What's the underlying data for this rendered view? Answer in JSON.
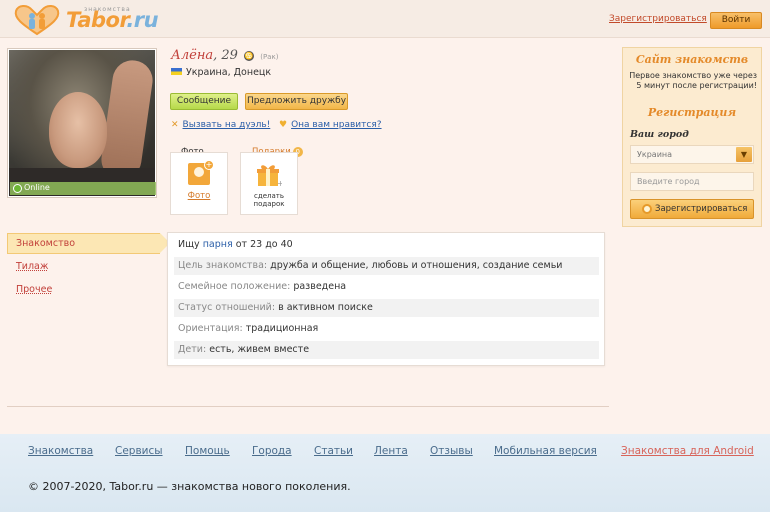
{
  "header": {
    "logo_text": "Tabor",
    "logo_tld": ".ru",
    "logo_subtitle": "знакомства",
    "register_label": "Зарегистрироваться",
    "login_label": "Войти"
  },
  "profile": {
    "name": "Алёна",
    "age": "29",
    "zodiac_label": "(Рак)",
    "location": "Украина, Донецк",
    "online_label": "Online",
    "message_button": "Сообщение",
    "friend_button": "Предложить дружбу",
    "duel_link": "Вызвать на дуэль!",
    "like_link": "Она вам нравится?",
    "photos_header": "Фото",
    "photos_count": "+",
    "photos_tile_label": "Фото",
    "gifts_header": "Подарки",
    "gifts_count": "0",
    "gift_tile_line1": "сделать",
    "gift_tile_line2": "подарок"
  },
  "tabs": {
    "active": "Знакомство",
    "items": [
      "Тилаж",
      "Прочее"
    ]
  },
  "info": {
    "seeking_prefix": "Ищу",
    "seeking_who": "парня",
    "seeking_ages": "от 23 до 40",
    "rows": [
      {
        "key": "Цель знакомства:",
        "value": "дружба и общение, любовь и отношения, создание семьи"
      },
      {
        "key": "Семейное положение:",
        "value": "разведена"
      },
      {
        "key": "Статус отношений:",
        "value": "в активном поиске"
      },
      {
        "key": "Ориентация:",
        "value": "традиционная"
      },
      {
        "key": "Дети:",
        "value": "есть, живем вместе"
      }
    ]
  },
  "sidebar": {
    "title": "Сайт знакомств",
    "description": "Первое знакомство уже через 5 минут после регистрации!",
    "reg_title": "Регистрация",
    "city_label": "Ваш город",
    "country_value": "Украина",
    "city_placeholder": "Введите город",
    "register_button": "Зарегистрироваться"
  },
  "footer": {
    "links": [
      "Знакомства",
      "Сервисы",
      "Помощь",
      "Города",
      "Статьи",
      "Лента",
      "Отзывы",
      "Мобильная версия",
      "Знакомства для Android"
    ],
    "copyright": "© 2007-2020, Tabor.ru — знакомства нового поколения."
  },
  "colors": {
    "accent_orange": "#f29d38",
    "name_red": "#c2403a",
    "link_blue": "#2a5ea8",
    "online_green": "#6cb634"
  }
}
